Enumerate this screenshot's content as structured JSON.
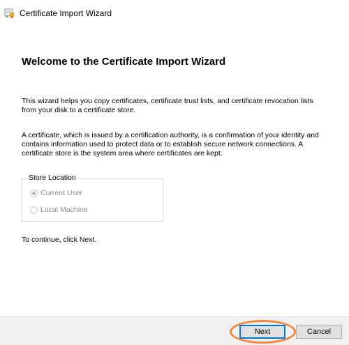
{
  "window": {
    "title": "Certificate Import Wizard",
    "icon": "certificate-icon"
  },
  "main": {
    "heading": "Welcome to the Certificate Import Wizard",
    "paragraph1": "This wizard helps you copy certificates, certificate trust lists, and certificate revocation lists from your disk to a certificate store.",
    "paragraph2": "A certificate, which is issued by a certification authority, is a confirmation of your identity and contains information used to protect data or to establish secure network connections. A certificate store is the system area where certificates are kept.",
    "store_location": {
      "label": "Store Location",
      "options": [
        {
          "label": "Current User",
          "selected": true,
          "enabled": false
        },
        {
          "label": "Local Machine",
          "selected": false,
          "enabled": false
        }
      ]
    },
    "continue_text": "To continue, click Next."
  },
  "footer": {
    "next_label": "Next",
    "cancel_label": "Cancel"
  },
  "colors": {
    "accent": "#0078d7",
    "highlight": "#f0883e",
    "footer_bg": "#f0f0f0"
  }
}
